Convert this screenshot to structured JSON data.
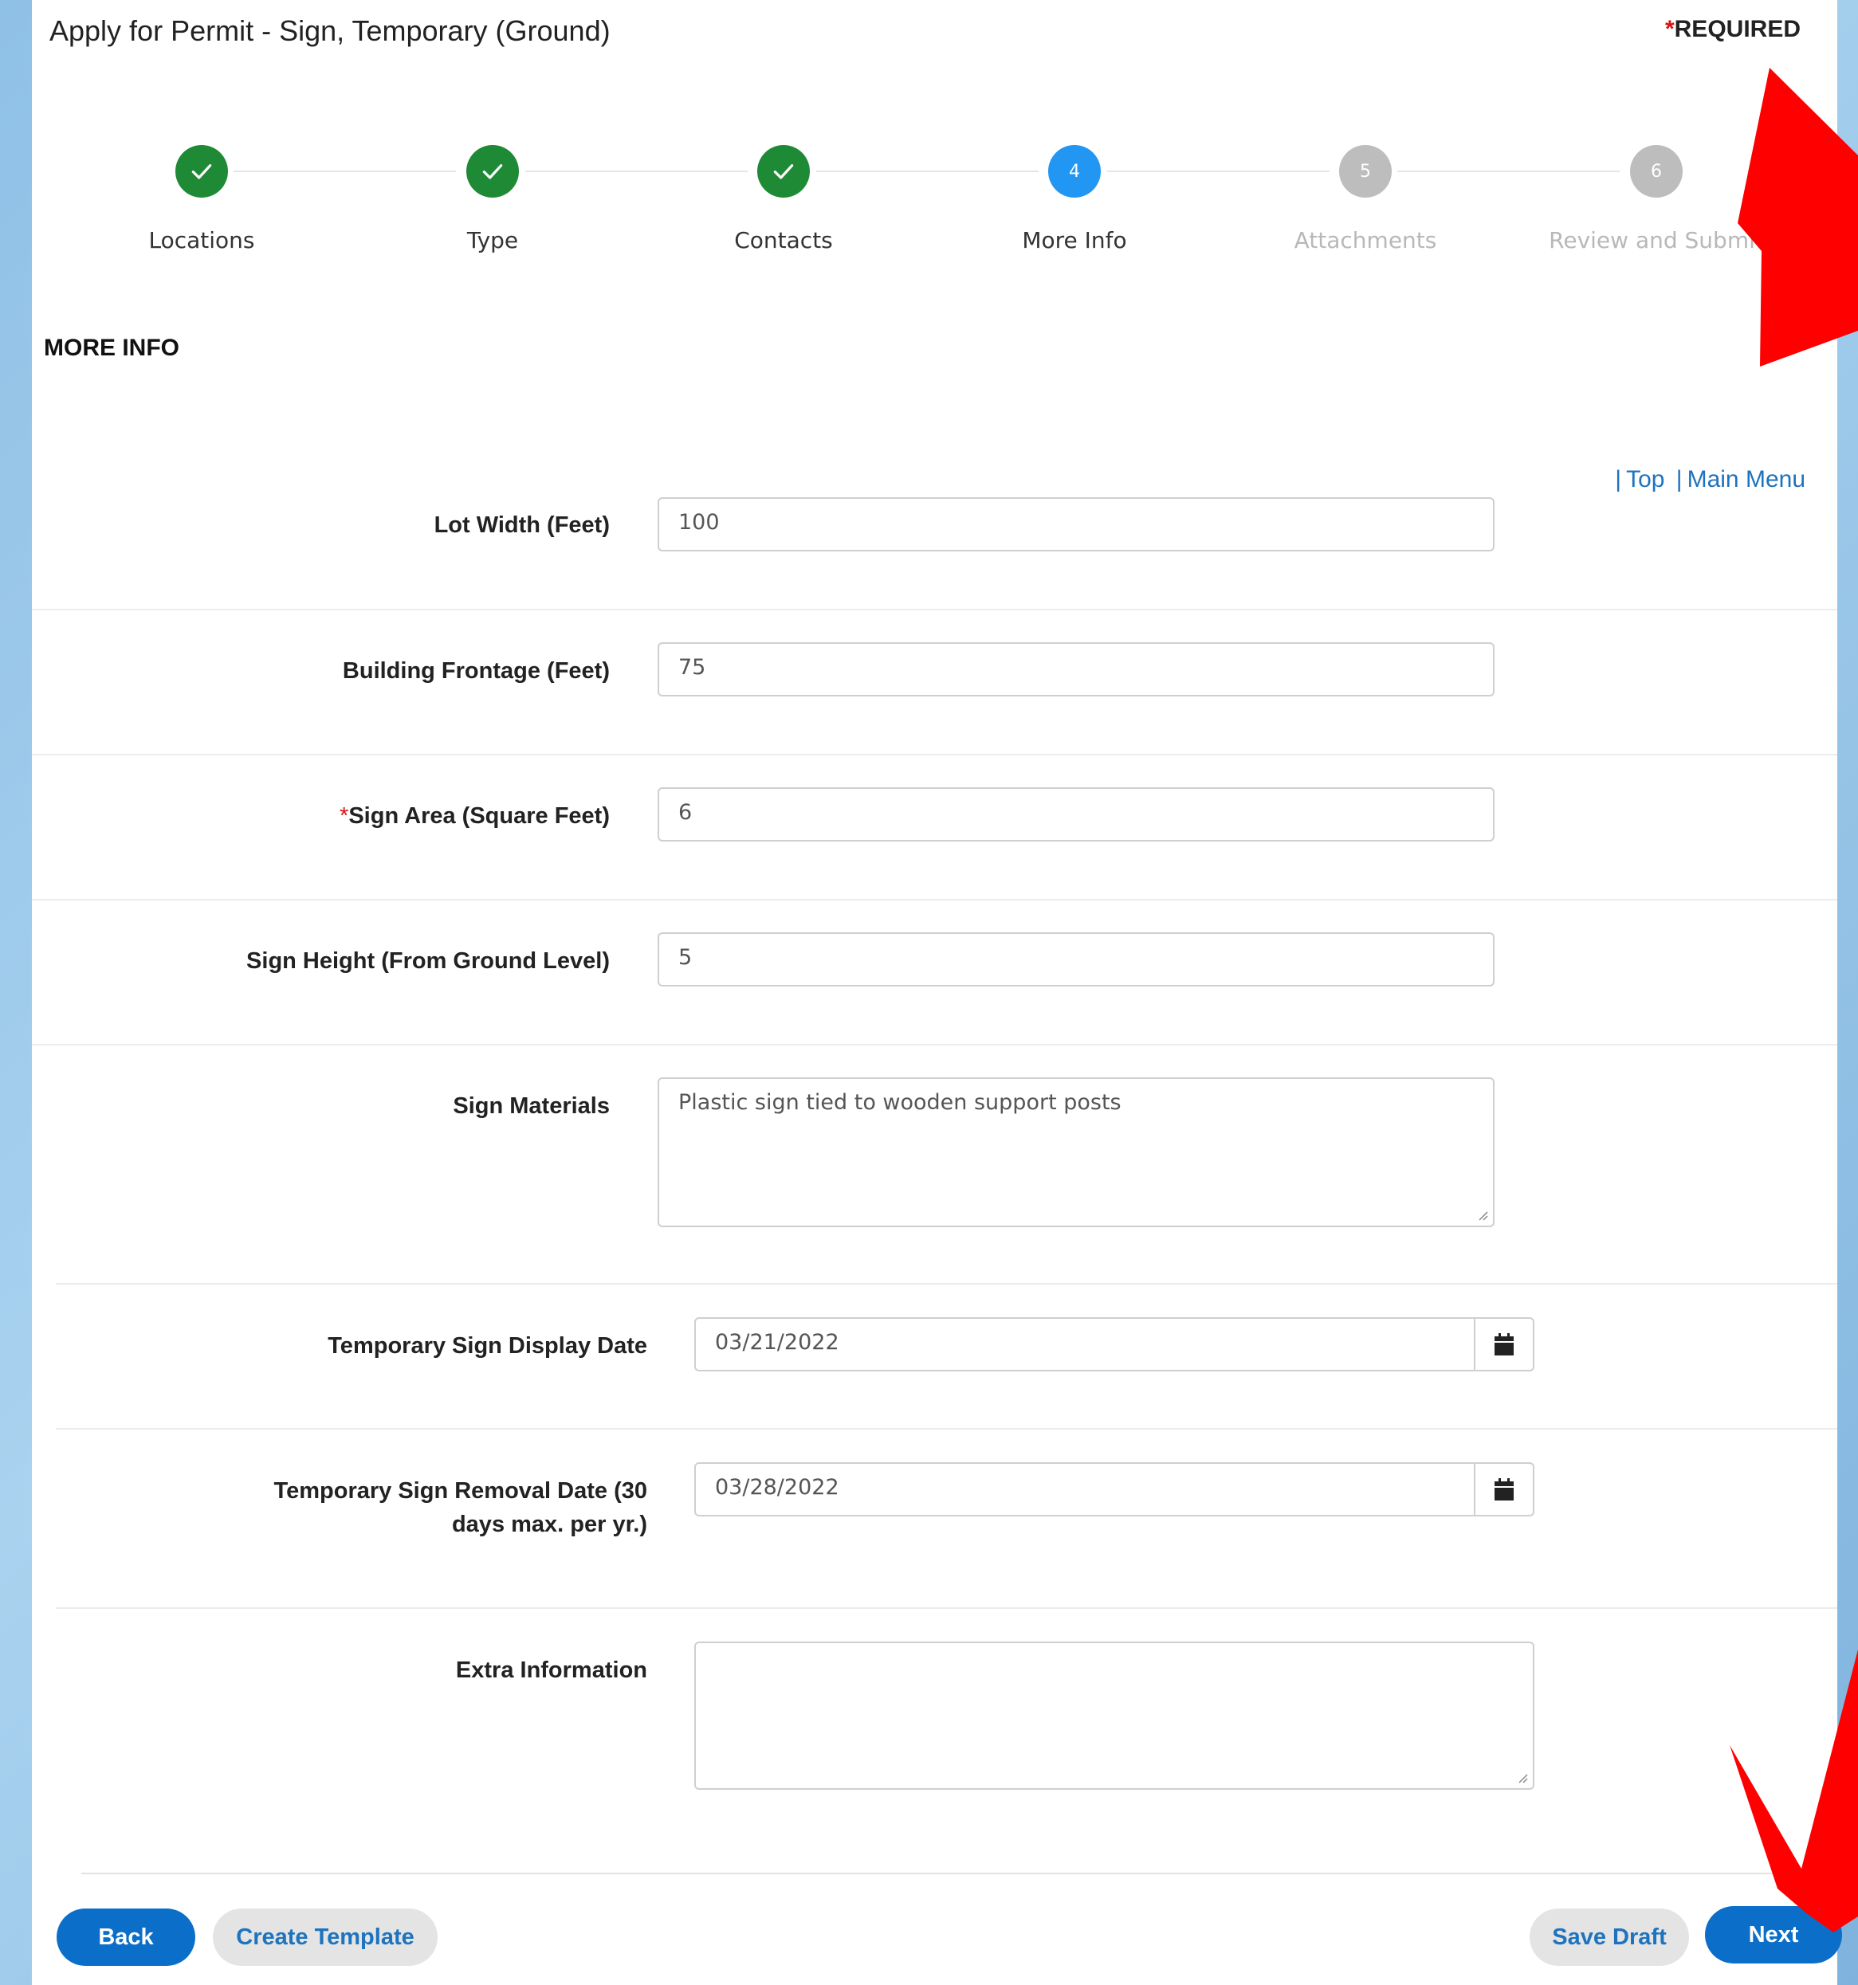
{
  "header": {
    "title": "Apply for Permit - Sign, Temporary (Ground)",
    "required_star": "*",
    "required_label": "REQUIRED"
  },
  "stepper": {
    "steps": [
      {
        "label": "Locations",
        "status": "complete",
        "number": ""
      },
      {
        "label": "Type",
        "status": "complete",
        "number": ""
      },
      {
        "label": "Contacts",
        "status": "complete",
        "number": ""
      },
      {
        "label": "More Info",
        "status": "current",
        "number": "4"
      },
      {
        "label": "Attachments",
        "status": "upcoming",
        "number": "5"
      },
      {
        "label": "Review and Submit",
        "status": "upcoming",
        "number": "6"
      }
    ]
  },
  "section": {
    "heading": "MORE INFO"
  },
  "nav_links": {
    "top": "Top",
    "main_menu": "Main Menu"
  },
  "fields": {
    "lot_width": {
      "label": "Lot Width (Feet)",
      "value": "100"
    },
    "building_frontage": {
      "label": "Building Frontage (Feet)",
      "value": "75"
    },
    "sign_area": {
      "required_star": "*",
      "label": "Sign Area (Square Feet)",
      "value": "6"
    },
    "sign_height": {
      "label": "Sign Height (From Ground Level)",
      "value": "5"
    },
    "sign_materials": {
      "label": "Sign Materials",
      "value": "Plastic sign tied to wooden support posts"
    },
    "display_date": {
      "label": "Temporary Sign Display Date",
      "value": "03/21/2022"
    },
    "removal_date": {
      "label_line1": "Temporary Sign Removal Date (30",
      "label_line2": "days max. per yr.)",
      "value": "03/28/2022"
    },
    "extra_info": {
      "label": "Extra Information",
      "value": ""
    }
  },
  "footer": {
    "back": "Back",
    "create_template": "Create Template",
    "save_draft": "Save Draft",
    "next": "Next"
  },
  "colors": {
    "complete": "#1f8a36",
    "current": "#2196f3",
    "upcoming": "#bdbdbd",
    "primary_button": "#0b6fc9",
    "link": "#1e73be",
    "required": "#d11111",
    "annotation_arrow": "#ff0000"
  },
  "icons": [
    "check-icon",
    "calendar-icon",
    "resize-grip-icon",
    "annotation-arrow"
  ]
}
